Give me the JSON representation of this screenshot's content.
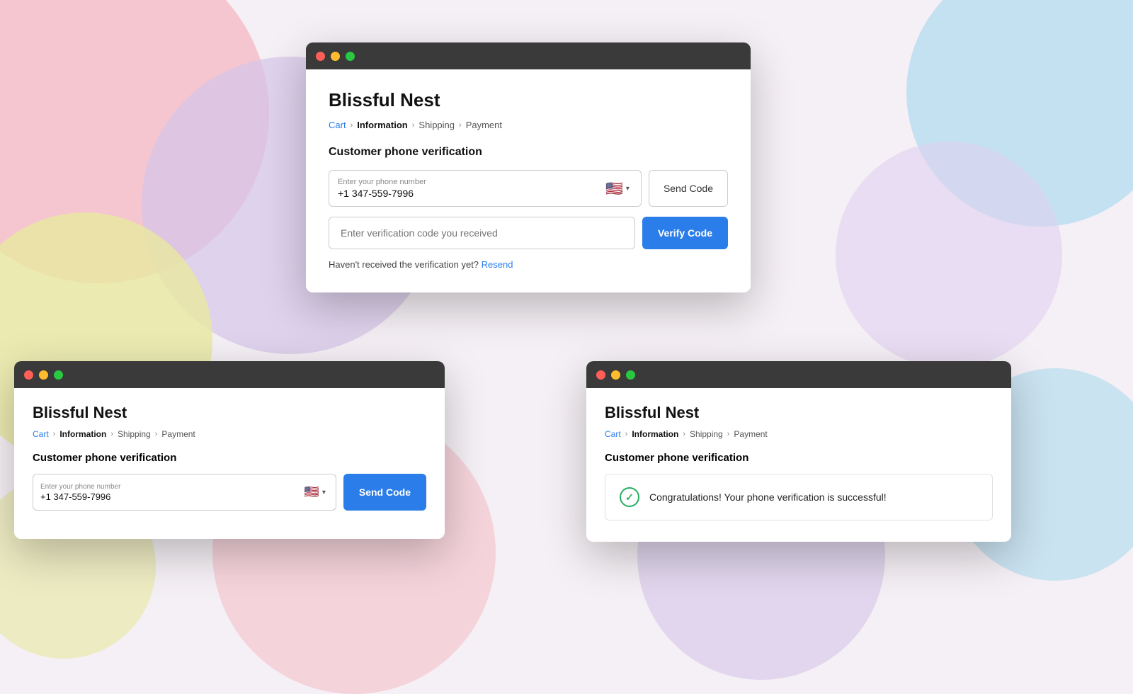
{
  "background": {
    "colors": {
      "pink": "#f5c6d0",
      "purple": "#d4c5e8",
      "yellow": "#e8e8a0",
      "blue": "#b8ddf0",
      "lavender": "#e0d0f0"
    }
  },
  "main_window": {
    "title": "Blissful Nest",
    "titlebar_buttons": [
      "red",
      "yellow",
      "green"
    ],
    "breadcrumb": {
      "cart": "Cart",
      "information": "Information",
      "shipping": "Shipping",
      "payment": "Payment"
    },
    "section_title": "Customer phone verification",
    "phone_field": {
      "label": "Enter your phone number",
      "value": "+1 347-559-7996",
      "flag": "🇺🇸"
    },
    "send_code_label": "Send Code",
    "verify_input_placeholder": "Enter verification code you received",
    "verify_code_label": "Verify Code",
    "resend_text": "Haven't received the verification yet?",
    "resend_link": "Resend"
  },
  "bottom_left_window": {
    "title": "Blissful Nest",
    "breadcrumb": {
      "cart": "Cart",
      "information": "Information",
      "shipping": "Shipping",
      "payment": "Payment"
    },
    "section_title": "Customer phone verification",
    "phone_field": {
      "label": "Enter your phone number",
      "value": "+1 347-559-7996",
      "flag": "🇺🇸"
    },
    "send_code_label": "Send Code"
  },
  "bottom_right_window": {
    "title": "Blissful Nest",
    "breadcrumb": {
      "cart": "Cart",
      "information": "Information",
      "shipping": "Shipping",
      "payment": "Payment"
    },
    "section_title": "Customer phone verification",
    "success_message": "Congratulations! Your phone verification is successful!"
  }
}
